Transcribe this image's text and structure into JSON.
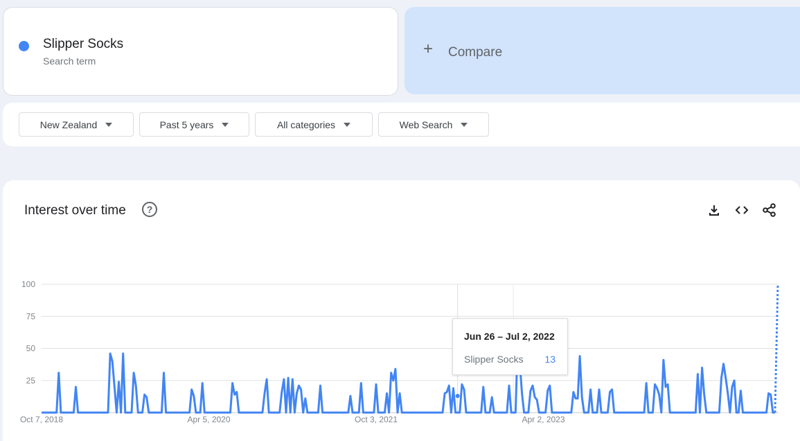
{
  "search_term": {
    "name": "Slipper Socks",
    "sub_label": "Search term",
    "color": "#4285f4"
  },
  "compare": {
    "label": "Compare"
  },
  "filters": [
    {
      "label": "New Zealand"
    },
    {
      "label": "Past 5 years"
    },
    {
      "label": "All categories"
    },
    {
      "label": "Web Search"
    }
  ],
  "panel": {
    "title": "Interest over time",
    "icons": [
      "help-icon",
      "download-icon",
      "embed-icon",
      "share-icon"
    ]
  },
  "tooltip": {
    "date": "Jun 26 – Jul 2, 2022",
    "term": "Slipper Socks",
    "value": "13"
  },
  "chart_data": {
    "type": "line",
    "title": "Interest over time",
    "xlabel": "",
    "ylabel": "",
    "ylim": [
      0,
      100
    ],
    "y_ticks": [
      "100",
      "75",
      "50",
      "25"
    ],
    "x_ticks": [
      "Oct 7, 2018",
      "Apr 5, 2020",
      "Oct 3, 2021",
      "Apr 2, 2023"
    ],
    "grid": true,
    "series": [
      {
        "name": "Slipper Socks",
        "color": "#4285f4",
        "start_week": "Oct 7, 2018",
        "interval": "weekly",
        "values": [
          0,
          0,
          0,
          0,
          0,
          0,
          0,
          0,
          31,
          0,
          0,
          0,
          0,
          0,
          0,
          0,
          20,
          0,
          0,
          0,
          0,
          0,
          0,
          0,
          0,
          0,
          0,
          0,
          0,
          0,
          0,
          0,
          46,
          40,
          20,
          0,
          24,
          0,
          46,
          0,
          0,
          0,
          0,
          31,
          21,
          0,
          0,
          0,
          14,
          12,
          0,
          0,
          0,
          0,
          0,
          0,
          0,
          31,
          0,
          0,
          0,
          0,
          0,
          0,
          0,
          0,
          0,
          0,
          0,
          0,
          18,
          13,
          0,
          0,
          0,
          23,
          0,
          0,
          0,
          0,
          0,
          0,
          0,
          0,
          0,
          0,
          0,
          0,
          0,
          23,
          14,
          16,
          0,
          0,
          0,
          0,
          0,
          0,
          0,
          0,
          0,
          0,
          0,
          0,
          15,
          26,
          0,
          0,
          0,
          0,
          0,
          0,
          16,
          26,
          0,
          27,
          0,
          26,
          0,
          15,
          21,
          18,
          0,
          11,
          0,
          0,
          0,
          0,
          0,
          0,
          21,
          0,
          0,
          0,
          0,
          0,
          0,
          0,
          0,
          0,
          0,
          0,
          0,
          0,
          13,
          0,
          0,
          0,
          0,
          23,
          0,
          0,
          0,
          0,
          0,
          0,
          22,
          0,
          0,
          0,
          0,
          15,
          0,
          31,
          25,
          34,
          0,
          15,
          0,
          0,
          0,
          0,
          0,
          0,
          0,
          0,
          0,
          0,
          0,
          0,
          0,
          0,
          0,
          0,
          0,
          0,
          0,
          0,
          15,
          16,
          21,
          0,
          19,
          0,
          0,
          0,
          22,
          18,
          0,
          0,
          0,
          0,
          0,
          0,
          0,
          0,
          20,
          0,
          0,
          0,
          12,
          0,
          0,
          0,
          0,
          0,
          0,
          0,
          21,
          0,
          0,
          0,
          54,
          38,
          15,
          0,
          0,
          0,
          17,
          21,
          12,
          10,
          0,
          0,
          0,
          0,
          17,
          21,
          0,
          0,
          0,
          0,
          0,
          0,
          0,
          0,
          0,
          0,
          16,
          11,
          11,
          44,
          12,
          0,
          0,
          0,
          18,
          0,
          0,
          0,
          18,
          0,
          0,
          0,
          0,
          16,
          18,
          0,
          0,
          0,
          0,
          0,
          0,
          0,
          0,
          0,
          0,
          0,
          0,
          0,
          0,
          0,
          23,
          0,
          0,
          0,
          22,
          19,
          14,
          0,
          41,
          20,
          22,
          0,
          0,
          0,
          0,
          0,
          0,
          0,
          0,
          0,
          0,
          0,
          0,
          0,
          30,
          0,
          35,
          14,
          0,
          0,
          0,
          0,
          0,
          0,
          0,
          27,
          38,
          27,
          15,
          0,
          20,
          25,
          0,
          0,
          17,
          0,
          0,
          0,
          0,
          0,
          0,
          0,
          0,
          0,
          0,
          0,
          0,
          15,
          14,
          0,
          0
        ]
      }
    ],
    "partial_point": {
      "value": 100
    }
  }
}
